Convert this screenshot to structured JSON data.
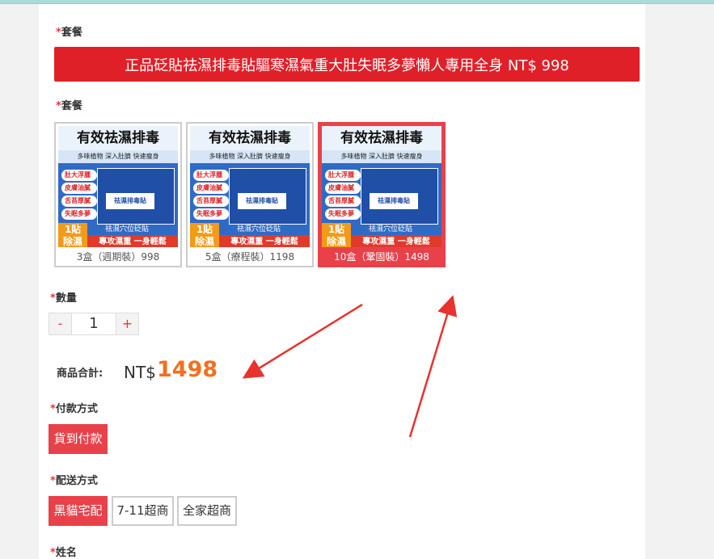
{
  "form": {
    "package_label_1": "套餐",
    "banner_text": "正品砭貼祛濕排毒貼驅寒濕氣重大肚失眠多夢懶人專用全身 NT$ 998",
    "package_label_2": "套餐",
    "packages": [
      {
        "caption": "3盒（週期裝）998",
        "selected": false
      },
      {
        "caption": "5盒（療程裝）1198",
        "selected": false
      },
      {
        "caption": "10盒（鞏固裝）1498",
        "selected": true
      }
    ],
    "product_image": {
      "headline": "有效祛濕排毒",
      "subline": "多味植物  深入肚臍  快速瘦身",
      "box_label": "祛濕排毒貼",
      "features": [
        "肚大浮腫",
        "皮膚油膩",
        "舌苔厚膩",
        "失眠多夢"
      ],
      "badge_line1": "1貼",
      "badge_line2": "除濕",
      "acupoint": "祛濕穴位砭貼",
      "strip": "專攻濕重 一身輕鬆"
    },
    "quantity_label": "數量",
    "quantity": {
      "minus": "-",
      "value": "1",
      "plus": "+"
    },
    "total_label": "商品合計:",
    "total_currency": "NT$",
    "total_value": "1498",
    "payment_label": "付款方式",
    "payment_options": [
      {
        "label": "貨到付款",
        "selected": true
      }
    ],
    "shipping_label": "配送方式",
    "shipping_options": [
      {
        "label": "黑貓宅配",
        "selected": true
      },
      {
        "label": "7-11超商",
        "selected": false
      },
      {
        "label": "全家超商",
        "selected": false
      }
    ],
    "name_label": "姓名",
    "required_mark": "*"
  },
  "colors": {
    "accent_red": "#e8414a",
    "banner_red": "#e02028",
    "total_orange": "#f36f1f",
    "annotation_arrow": "#e8322e"
  }
}
